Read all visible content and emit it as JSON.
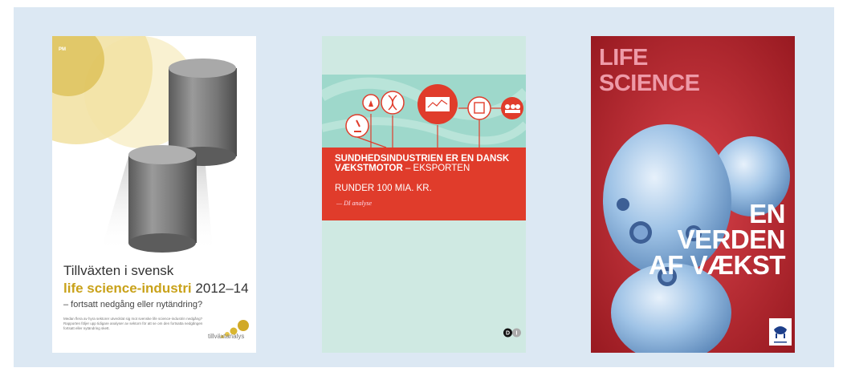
{
  "covers": [
    {
      "tag": "PM",
      "title_line1": "Tillväxten i svensk",
      "title_highlight": "life science-industri",
      "title_years": "2012–14",
      "subtitle": "– fortsatt nedgång eller nytändring?",
      "blurb": "Medan flera av hyra sektorer utvecklat sig mot svenske life science-industrin nedgång? Rapporten följer upp tidigare analyser av sektorn för att se om den fortsatta nedgången fortsatt eller nytändring skett.",
      "brand": "tillväxtanalys"
    },
    {
      "headline_bold": "SUNDHEDSINDUSTRIEN ER EN DANSK VÆKSTMOTOR",
      "headline_rest": " – EKSPORTEN",
      "headline_line3": "RUNDER 100 MIA. KR.",
      "byline": "— DI analyse",
      "logo_letters": [
        "D",
        "I"
      ]
    },
    {
      "title_line1": "LIFE",
      "title_line2": "SCIENCE",
      "slogan_line1": "EN",
      "slogan_line2": "VERDEN",
      "slogan_line3": "AF VÆKST"
    }
  ],
  "colors": {
    "panel": "#dce8f3",
    "cover1_accent": "#c9a21a",
    "cover2_band": "#e03c2b",
    "cover2_bg": "#cfe9e2",
    "cover3_bg": "#b52026",
    "cover3_title": "#ee9aa8"
  }
}
